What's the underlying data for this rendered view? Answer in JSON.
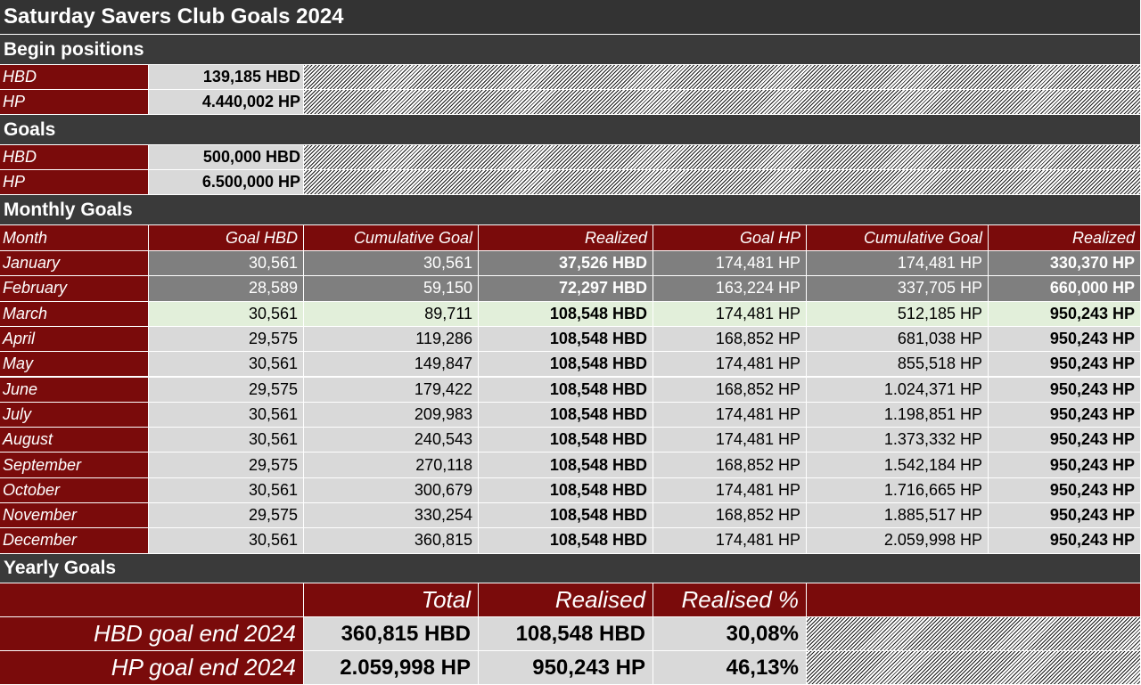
{
  "title": "Saturday Savers Club Goals 2024",
  "begin": {
    "section": "Begin positions",
    "rows": [
      {
        "label": "HBD",
        "value": "139,185 HBD"
      },
      {
        "label": "HP",
        "value": "4.440,002 HP"
      }
    ]
  },
  "goals": {
    "section": "Goals",
    "rows": [
      {
        "label": "HBD",
        "value": "500,000 HBD"
      },
      {
        "label": "HP",
        "value": "6.500,000 HP"
      }
    ]
  },
  "monthly": {
    "section": "Monthly Goals",
    "headers": [
      "Month",
      "Goal HBD",
      "Cumulative Goal",
      "Realized",
      "Goal HP",
      "Cumulative Goal",
      "Realized"
    ],
    "rows": [
      {
        "month": "January",
        "goal_hbd": "30,561",
        "cum_hbd": "30,561",
        "real_hbd": "37,526 HBD",
        "goal_hp": "174,481 HP",
        "cum_hp": "174,481 HP",
        "real_hp": "330,370 HP",
        "style": "gray"
      },
      {
        "month": "February",
        "goal_hbd": "28,589",
        "cum_hbd": "59,150",
        "real_hbd": "72,297 HBD",
        "goal_hp": "163,224 HP",
        "cum_hp": "337,705 HP",
        "real_hp": "660,000 HP",
        "style": "gray"
      },
      {
        "month": "March",
        "goal_hbd": "30,561",
        "cum_hbd": "89,711",
        "real_hbd": "108,548 HBD",
        "goal_hp": "174,481 HP",
        "cum_hp": "512,185 HP",
        "real_hp": "950,243 HP",
        "style": "green"
      },
      {
        "month": "April",
        "goal_hbd": "29,575",
        "cum_hbd": "119,286",
        "real_hbd": "108,548 HBD",
        "goal_hp": "168,852 HP",
        "cum_hp": "681,038 HP",
        "real_hp": "950,243 HP",
        "style": "light"
      },
      {
        "month": "May",
        "goal_hbd": "30,561",
        "cum_hbd": "149,847",
        "real_hbd": "108,548 HBD",
        "goal_hp": "174,481 HP",
        "cum_hp": "855,518 HP",
        "real_hp": "950,243 HP",
        "style": "light"
      },
      {
        "month": "June",
        "goal_hbd": "29,575",
        "cum_hbd": "179,422",
        "real_hbd": "108,548 HBD",
        "goal_hp": "168,852 HP",
        "cum_hp": "1.024,371 HP",
        "real_hp": "950,243 HP",
        "style": "light"
      },
      {
        "month": "July",
        "goal_hbd": "30,561",
        "cum_hbd": "209,983",
        "real_hbd": "108,548 HBD",
        "goal_hp": "174,481 HP",
        "cum_hp": "1.198,851 HP",
        "real_hp": "950,243 HP",
        "style": "light"
      },
      {
        "month": "August",
        "goal_hbd": "30,561",
        "cum_hbd": "240,543",
        "real_hbd": "108,548 HBD",
        "goal_hp": "174,481 HP",
        "cum_hp": "1.373,332 HP",
        "real_hp": "950,243 HP",
        "style": "light"
      },
      {
        "month": "September",
        "goal_hbd": "29,575",
        "cum_hbd": "270,118",
        "real_hbd": "108,548 HBD",
        "goal_hp": "168,852 HP",
        "cum_hp": "1.542,184 HP",
        "real_hp": "950,243 HP",
        "style": "light"
      },
      {
        "month": "October",
        "goal_hbd": "30,561",
        "cum_hbd": "300,679",
        "real_hbd": "108,548 HBD",
        "goal_hp": "174,481 HP",
        "cum_hp": "1.716,665 HP",
        "real_hp": "950,243 HP",
        "style": "light"
      },
      {
        "month": "November",
        "goal_hbd": "29,575",
        "cum_hbd": "330,254",
        "real_hbd": "108,548 HBD",
        "goal_hp": "168,852 HP",
        "cum_hp": "1.885,517 HP",
        "real_hp": "950,243 HP",
        "style": "light"
      },
      {
        "month": "December",
        "goal_hbd": "30,561",
        "cum_hbd": "360,815",
        "real_hbd": "108,548 HBD",
        "goal_hp": "174,481 HP",
        "cum_hp": "2.059,998 HP",
        "real_hp": "950,243 HP",
        "style": "light"
      }
    ]
  },
  "yearly": {
    "section": "Yearly Goals",
    "headers": [
      "Total",
      "Realised",
      "Realised %"
    ],
    "rows": [
      {
        "label": "HBD goal end 2024",
        "total": "360,815 HBD",
        "realised": "108,548 HBD",
        "pct": "30,08%"
      },
      {
        "label": "HP goal end 2024",
        "total": "2.059,998 HP",
        "realised": "950,243 HP",
        "pct": "46,13%"
      }
    ]
  },
  "colors": {
    "accent": "#7a0b0b",
    "header_dark": "#333333",
    "cell_light": "#d9d9d9",
    "cell_gray": "#7f7f7f",
    "current_month": "#e2efda"
  }
}
